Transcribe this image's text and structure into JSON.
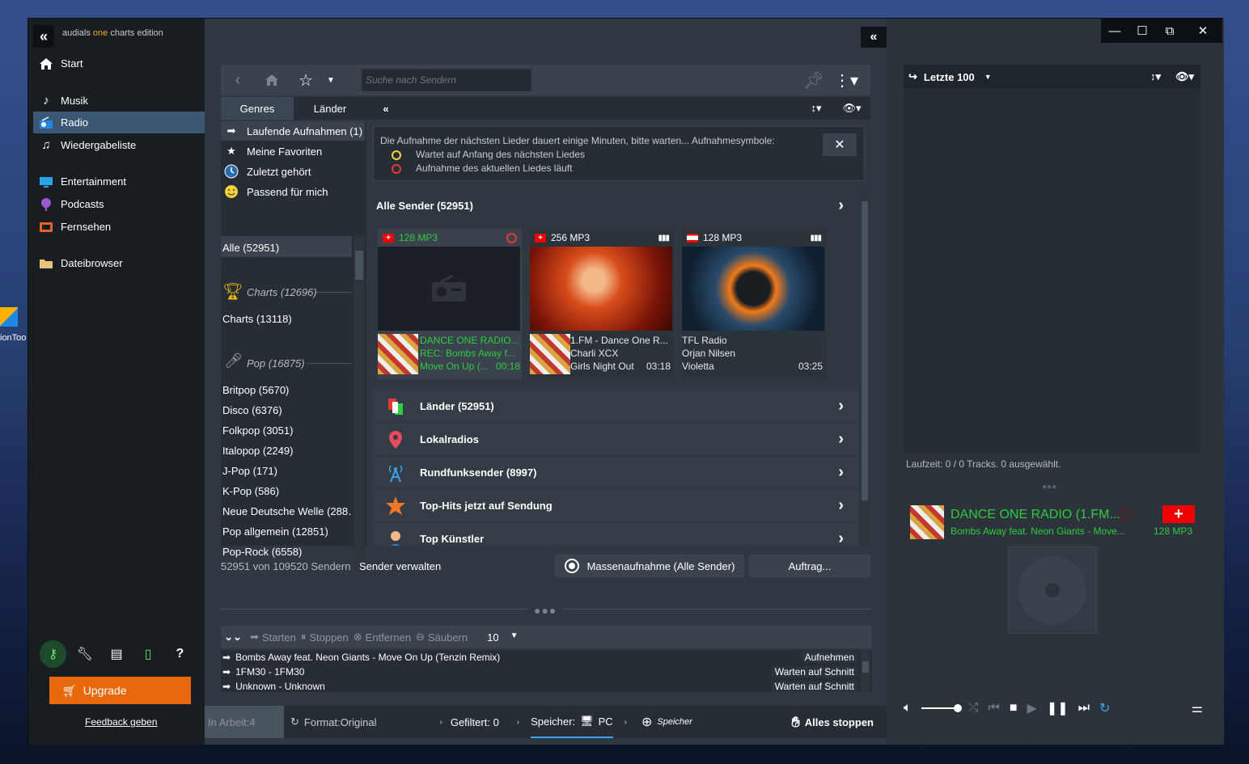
{
  "desktop": {
    "icon_label": "ionToo"
  },
  "app": {
    "title_prefix": "audials ",
    "title_one": "one",
    "title_suffix": " charts edition"
  },
  "nav": [
    {
      "label": "Start"
    },
    {
      "label": "Musik"
    },
    {
      "label": "Radio"
    },
    {
      "label": "Wiedergabeliste"
    },
    {
      "label": "Entertainment"
    },
    {
      "label": "Podcasts"
    },
    {
      "label": "Fernsehen"
    },
    {
      "label": "Dateibrowser"
    }
  ],
  "sidebar_bottom": {
    "upgrade": "Upgrade",
    "feedback": "Feedback geben"
  },
  "toolbar": {
    "search_placeholder": "Suche nach Sendern"
  },
  "tabs": {
    "genres": "Genres",
    "laender": "Länder"
  },
  "left_panel": {
    "quick": [
      "Laufende Aufnahmen (1)",
      "Meine Favoriten",
      "Zuletzt gehört",
      "Passend für mich"
    ],
    "all": "Alle (52951)",
    "charts_cat": "Charts (12696)",
    "charts_item": "Charts (13118)",
    "pop_cat": "Pop (16875)",
    "genres": [
      "Britpop (5670)",
      "Disco (6376)",
      "Folkpop (3051)",
      "Italopop (2249)",
      "J-Pop (171)",
      "K-Pop (586)",
      "Neue Deutsche Welle (288…",
      "Pop allgemein (12851)",
      "Pop-Rock (6558)"
    ]
  },
  "info": {
    "text": "Die Aufnahme der nächsten Lieder dauert einige Minuten, bitte warten... Aufnahmesymbole:",
    "wait": "Wartet auf Anfang des nächsten Liedes",
    "rec": "Aufnahme des aktuellen Liedes läuft",
    "close": "✕"
  },
  "stations": {
    "header": "Alle Sender (52951)",
    "cards": [
      {
        "quality": "128 MP3",
        "line1": "DANCE ONE RADIO...",
        "line2": "REC: Bombs Away f...",
        "line3": "Move On Up (...",
        "time": "00:18"
      },
      {
        "quality": "256 MP3",
        "line1": "1.FM - Dance One R...",
        "line2": "Charli XCX",
        "line3": "Girls Night Out",
        "time": "03:18"
      },
      {
        "quality": "128 MP3",
        "line1": "TFL Radio",
        "line2": "Orjan Nilsen",
        "line3": "Violetta",
        "time": "03:25"
      }
    ],
    "categories": [
      "Länder (52951)",
      "Lokalradios",
      "Rundfunksender (8997)",
      "Top-Hits jetzt auf Sendung",
      "Top Künstler"
    ]
  },
  "status": {
    "count": "52951 von 109520 Sendern",
    "manage": "Sender verwalten",
    "mass": "Massenaufnahme (Alle Sender)",
    "auftrag": "Auftrag..."
  },
  "downloads": {
    "toolbar": {
      "start": "Starten",
      "stop": "Stoppen",
      "remove": "Entfernen",
      "clean": "Säubern",
      "count": "10"
    },
    "rows": [
      {
        "title": "Bombs Away feat. Neon Giants - Move On Up (Tenzin Remix)",
        "status": "Aufnehmen"
      },
      {
        "title": "1FM30 - 1FM30",
        "status": "Warten auf Schnitt"
      },
      {
        "title": "Unknown - Unknown",
        "status": "Warten auf Schnitt"
      }
    ]
  },
  "statusbar": {
    "inarbeit": "In Arbeit:4",
    "format": "Format:Original",
    "gefiltert": "Gefiltert: 0",
    "speicher_label": "Speicher:",
    "speicher_pc": "PC",
    "speicher_add": "Speicher",
    "stop_all": "Alles stoppen"
  },
  "right": {
    "header": "Letzte 100",
    "laufzeit": "Laufzeit: 0 / 0 Tracks.  0 ausgewählt.",
    "now_title": "DANCE ONE RADIO (1.FM...",
    "now_sub": "Bombs Away feat. Neon Giants - Move...",
    "now_quality": "128 MP3"
  },
  "colors": {
    "accent_green": "#2ecc40",
    "upgrade_orange": "#e8690c",
    "active_nav": "#3b5773"
  }
}
